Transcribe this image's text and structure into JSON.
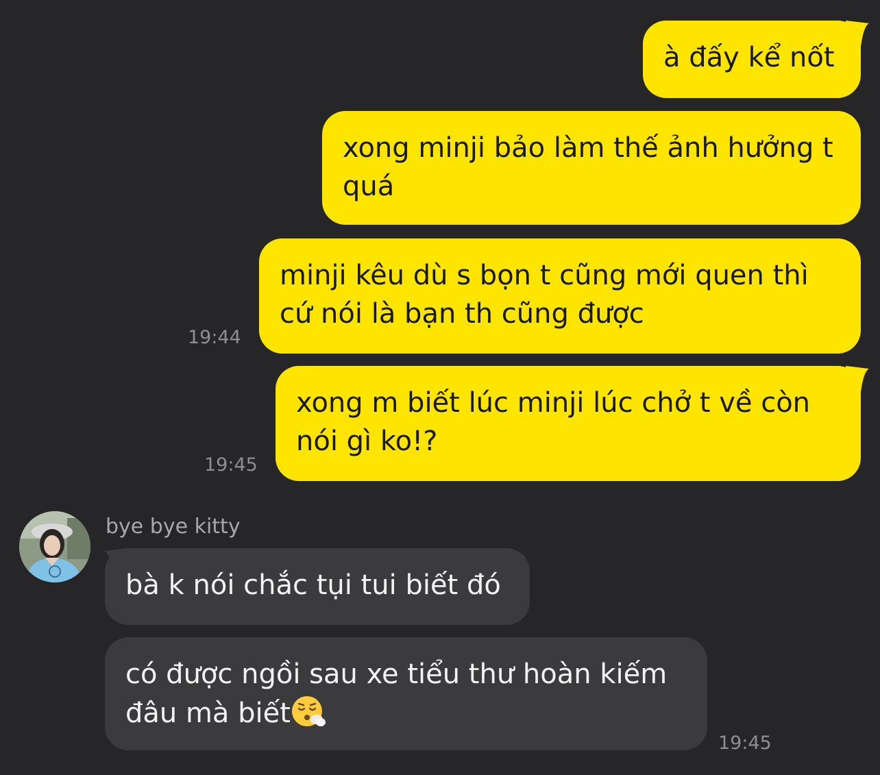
{
  "conversation": {
    "outgoing": [
      {
        "text": "à đấy kể nốt",
        "time": ""
      },
      {
        "text": "xong minji bảo làm thế ảnh hưởng t quá",
        "time": ""
      },
      {
        "text": "minji kêu dù s bọn t cũng mới quen thì cứ nói là bạn th cũng được",
        "time": "19:44"
      },
      {
        "text": "xong m biết lúc minji lúc chở t về còn nói gì ko!?",
        "time": "19:45"
      }
    ],
    "incoming": {
      "sender_name": "bye bye kitty",
      "avatar_icon": "profile-photo",
      "messages": [
        {
          "text": "bà k nói chắc tụi tui biết đó",
          "time": ""
        },
        {
          "text": "có được ngồi sau xe tiểu thư hoàn kiếm đâu mà biết",
          "emoji": "face-exhaling-emoji",
          "time": "19:45"
        }
      ]
    }
  },
  "colors": {
    "background": "#262628",
    "outgoing_bubble": "#FEE500",
    "incoming_bubble": "#3B3B3D",
    "timestamp": "#8E8E93"
  }
}
